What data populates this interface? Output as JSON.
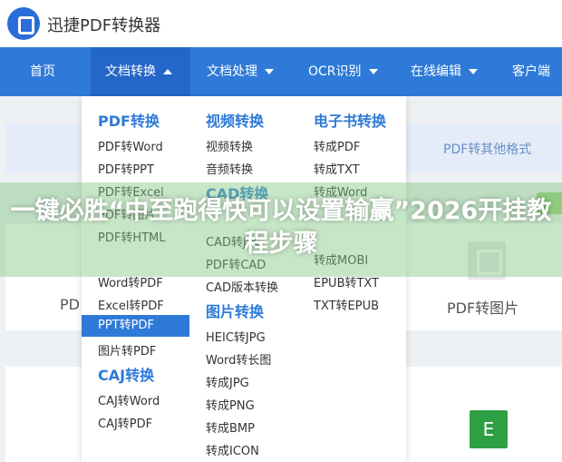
{
  "header": {
    "brand": "迅捷PDF转换器"
  },
  "nav": {
    "items": [
      {
        "label": "首页",
        "has_caret": false
      },
      {
        "label": "文档转换",
        "has_caret": true,
        "active": true
      },
      {
        "label": "文档处理",
        "has_caret": true
      },
      {
        "label": "OCR识别",
        "has_caret": true
      },
      {
        "label": "在线编辑",
        "has_caret": true
      },
      {
        "label": "客户端",
        "has_caret": true
      }
    ]
  },
  "content": {
    "subbar_text": "PDF转其他格式",
    "card1_left_label": "PD",
    "card1_right_label": "PDF转图片",
    "card2_icon_letter": "E"
  },
  "dropdown": {
    "col1": {
      "title": "PDF转换",
      "items": [
        "PDF转Word",
        "PDF转PPT",
        "PDF转Excel",
        "PDF转图片",
        "PDF转HTML",
        "Word转PDF",
        "Excel转PDF",
        "PPT转PDF",
        "图片转PDF"
      ],
      "title2": "CAJ转换",
      "items2": [
        "CAJ转Word",
        "CAJ转PDF"
      ]
    },
    "col2": {
      "title": "视频转换",
      "items": [
        "视频转换",
        "音频转换"
      ],
      "title2": "CAD转换",
      "items2": [
        "CAD转JPG",
        "PDF转CAD",
        "CAD版本转换"
      ],
      "title3": "图片转换",
      "items3": [
        "HEIC转JPG",
        "Word转长图",
        "转成JPG",
        "转成PNG",
        "转成BMP",
        "转成ICON"
      ]
    },
    "col3": {
      "title": "电子书转换",
      "items": [
        "转成PDF",
        "转成TXT",
        "转成Word",
        "转成MOBI",
        "EPUB转TXT",
        "TXT转EPUB"
      ]
    }
  },
  "overlay": {
    "text": "一键必胜“中至跑得快可以设置输赢”2026开挂教程步骤"
  }
}
